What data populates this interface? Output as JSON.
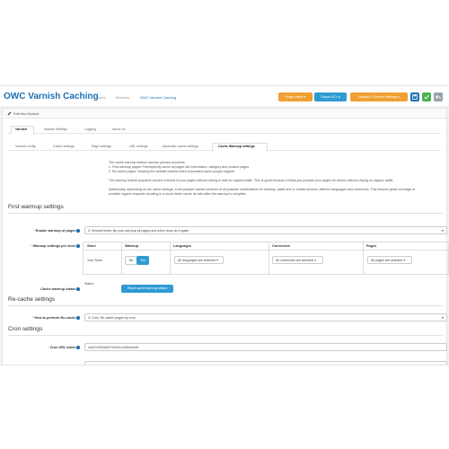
{
  "header": {
    "title": "OWC Varnish Caching",
    "breadcrumbs": [
      "Home",
      "Modules",
      "OWC Varnish Caching"
    ],
    "buttons": {
      "purge_cache": "Purge cache",
      "export_vcl": "Export VCL",
      "backup_restore": "Backup & Restore settings"
    }
  },
  "panel": {
    "heading": "Edit this Module"
  },
  "tabs": [
    "Varnish",
    "Module Settings",
    "Logging",
    "About Us"
  ],
  "subtabs": [
    "Varnish config",
    "Cache settings",
    "Page settings",
    "URL settings",
    "Automatic cache settings",
    "Cache Warmup settings"
  ],
  "intro": [
    "The cache warmup feature has two primary functions:",
    "1. First warmup pages: Preemptively cache all pages like information, category and product pages",
    "2. Re-cache pages: Keeping the website cached when automated cache purges happen",
    "",
    "The warmup feature prepares cached versions of your pages without having to wait for organic traffic. This is great because it helps you prepare your pages for visitors without relying on organic traffic.",
    "",
    "Additionally, depending on the cache settings, it will prepare cached versions of all possible combinations for desktop, tablet and or mobile devices, different languages and currencies. This ensures great coverage of",
    "possible organic requests resulting in a much better cache hit ratio after the warmup is complete."
  ],
  "first_warmup": {
    "section_title": "First warmup settings",
    "enable_label": "Enable warmup of pages",
    "enable_value": "3: Several times: By cron warmup all pages and when done do it again",
    "per_store_label": "Warmup settings per store",
    "columns": [
      "Store",
      "Warmup",
      "Languages",
      "Currencies",
      "Pages"
    ],
    "row": {
      "store": "Your Store",
      "warmup_no": "No",
      "warmup_yes": "Yes",
      "languages": "All languages are selected",
      "currencies": "All currencies are selected",
      "pages": "All pages are selected"
    },
    "status_label": "Cache warmup status",
    "status_value": "Status",
    "reset_button": "Reset cache warmup status"
  },
  "recache": {
    "section_title": "Re-cache settings",
    "how_label": "How to perform Re-cache",
    "how_value": "3: Cron: Re-cache pages by cron"
  },
  "cron": {
    "section_title": "Cron settings",
    "token_label": "Cron URL token",
    "token_value": "4aeFrd2f5fa8f579d3f4e1df6e80ad6"
  }
}
